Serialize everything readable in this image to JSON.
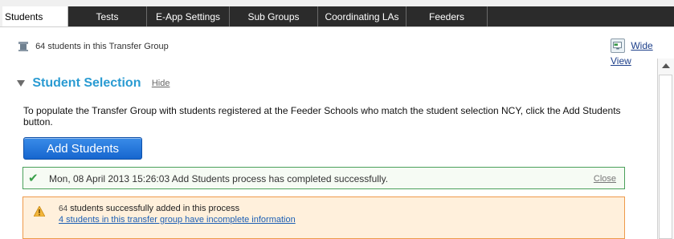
{
  "tabs": [
    {
      "label": "Students",
      "active": true
    },
    {
      "label": "Tests",
      "active": false
    },
    {
      "label": "E-App Settings",
      "active": false
    },
    {
      "label": "Sub Groups",
      "active": false
    },
    {
      "label": "Coordinating LAs",
      "active": false
    },
    {
      "label": "Feeders",
      "active": false
    }
  ],
  "group_info": {
    "icon": "students-group-icon",
    "text": "64 students in this Transfer Group"
  },
  "wide_view": {
    "icon": "wide-view-icon",
    "label": "Wide View"
  },
  "section": {
    "title": "Student Selection",
    "hide_label": "Hide"
  },
  "description": "To populate the Transfer Group with students registered at the Feeder Schools who match the student selection NCY, click the Add Students button.",
  "add_button": {
    "label": "Add Students"
  },
  "success_message": {
    "text": "Mon, 08 April 2013 15:26:03 Add Students process has completed successfully.",
    "close_label": "Close",
    "color": "#3aa04a"
  },
  "warning": {
    "count": "64",
    "text": "students successfully added in this process",
    "link": "4 students in this transfer group have incomplete information",
    "color": "#ee9a4a"
  },
  "colors": {
    "accent": "#2a9bd2",
    "button": "#1666cf",
    "tabbar": "#2b2b2b"
  }
}
